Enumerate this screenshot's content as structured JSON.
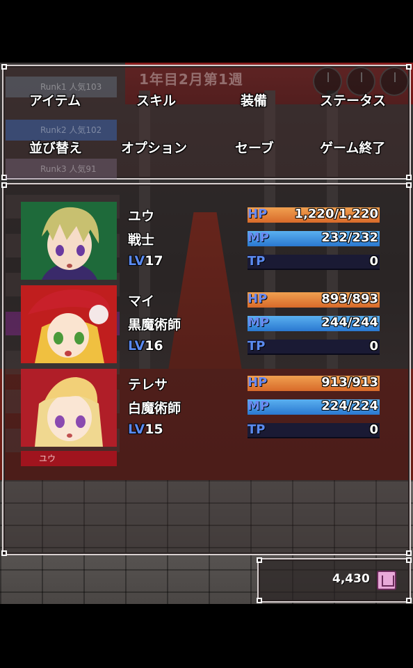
{
  "calendar": {
    "week_title": "1年目2月第1週"
  },
  "menu": {
    "row1": [
      "アイテム",
      "スキル",
      "装備",
      "ステータス"
    ],
    "row2": [
      "並び替え",
      "オプション",
      "セーブ",
      "ゲーム終了"
    ]
  },
  "ranking": [
    {
      "label": "Runk1 人気103"
    },
    {
      "label": "Runk2 人気102"
    },
    {
      "label": "Runk3 人気91"
    }
  ],
  "party": [
    {
      "name": "ユウ",
      "job": "戦士",
      "lv_prefix": "LV",
      "lv": "17",
      "hp_label": "HP",
      "hp_text": "1,220/1,220",
      "hp_fraction": 1.0,
      "mp_label": "MP",
      "mp_text": "232/232",
      "mp_fraction": 1.0,
      "tp_label": "TP",
      "tp_text": "0",
      "tp_fraction": 0,
      "hair_color": "#c8c070"
    },
    {
      "name": "マイ",
      "job": "黒魔術師",
      "lv_prefix": "LV",
      "lv": "16",
      "hp_label": "HP",
      "hp_text": "893/893",
      "hp_fraction": 1.0,
      "mp_label": "MP",
      "mp_text": "244/244",
      "mp_fraction": 1.0,
      "tp_label": "TP",
      "tp_text": "0",
      "tp_fraction": 0,
      "hair_color": "#f0c040"
    },
    {
      "name": "テレサ",
      "job": "白魔術師",
      "lv_prefix": "LV",
      "lv": "15",
      "hp_label": "HP",
      "hp_text": "913/913",
      "hp_fraction": 1.0,
      "mp_label": "MP",
      "mp_text": "224/224",
      "mp_fraction": 1.0,
      "tp_label": "TP",
      "tp_text": "0",
      "tp_fraction": 0,
      "hair_color": "#f0d890"
    }
  ],
  "name_tag": "ユウ",
  "gold": {
    "amount": "4,430",
    "icon": "shop-icon"
  }
}
